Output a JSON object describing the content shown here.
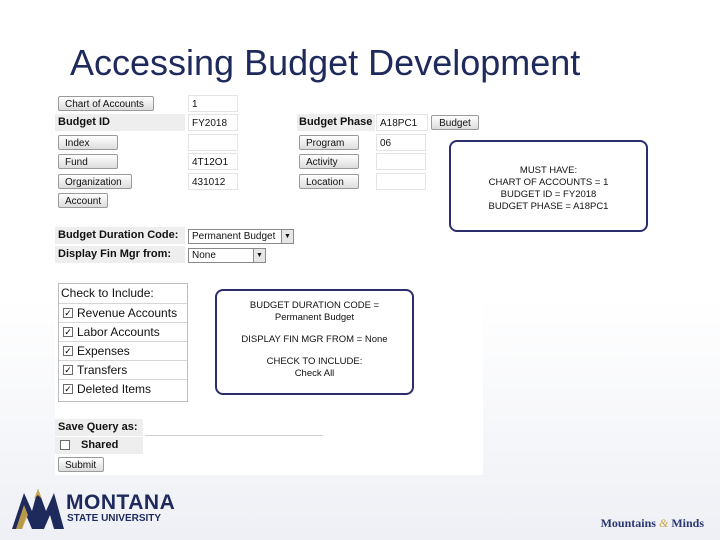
{
  "slide": {
    "title": "Accessing Budget Development"
  },
  "form": {
    "chart_of_accounts_label": "Chart of Accounts",
    "chart_of_accounts_value": "1",
    "budget_id_label": "Budget ID",
    "budget_id_value": "FY2018",
    "budget_phase_label": "Budget Phase",
    "budget_phase_value": "A18PC1",
    "budget_button": "Budget",
    "index_label": "Index",
    "program_label": "Program",
    "program_value": "06",
    "fund_label": "Fund",
    "fund_value": "4T12O1",
    "activity_label": "Activity",
    "organization_label": "Organization",
    "organization_value": "431012",
    "location_label": "Location",
    "account_label": "Account",
    "duration_label": "Budget Duration Code:",
    "duration_value": "Permanent Budget",
    "display_fin_label": "Display Fin Mgr from:",
    "display_fin_value": "None",
    "check_include_label": "Check to Include:",
    "include_items": [
      "Revenue Accounts",
      "Labor Accounts",
      "Expenses",
      "Transfers",
      "Deleted Items"
    ],
    "save_query_label": "Save Query as:",
    "shared_label": "Shared",
    "submit_label": "Submit"
  },
  "callouts": {
    "must_have": [
      "MUST HAVE:",
      "CHART OF ACCOUNTS = 1",
      "BUDGET ID = FY2018",
      "BUDGET PHASE = A18PC1"
    ],
    "duration": [
      "BUDGET DURATION CODE =",
      "Permanent Budget",
      "DISPLAY FIN MGR FROM = None",
      "CHECK TO INCLUDE:",
      "Check All"
    ]
  },
  "branding": {
    "logo_line1": "MONTANA",
    "logo_line2": "STATE UNIVERSITY",
    "footer_left": "Mountains",
    "footer_amp": "&",
    "footer_right": "Minds",
    "colors": {
      "navy": "#1f2a5c",
      "gold": "#c9a54a"
    }
  }
}
